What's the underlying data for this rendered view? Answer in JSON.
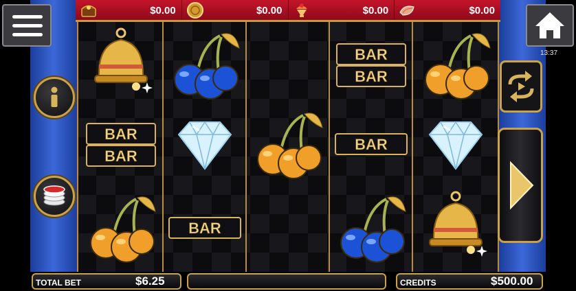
{
  "jackpots": [
    {
      "icon": "treasure-chest-icon",
      "value": "$0.00"
    },
    {
      "icon": "gold-coin-icon",
      "value": "$0.00"
    },
    {
      "icon": "sundae-icon",
      "value": "$0.00"
    },
    {
      "icon": "seashell-icon",
      "value": "$0.00"
    }
  ],
  "status": {
    "clock": "13:37"
  },
  "reels": [
    [
      "bell",
      "double-bar",
      "cherries-gold"
    ],
    [
      "cherries-blue",
      "diamond",
      "single-bar"
    ],
    [
      "empty",
      "cherries-gold",
      "empty"
    ],
    [
      "double-bar",
      "single-bar",
      "cherries-blue"
    ],
    [
      "cherries-gold",
      "diamond",
      "bell"
    ]
  ],
  "symbol_text": {
    "bar": "BAR"
  },
  "footer": {
    "total_bet_label": "TOTAL BET",
    "total_bet_value": "$6.25",
    "message": "",
    "credits_label": "CREDITS",
    "credits_value": "$500.00"
  },
  "buttons": {
    "menu": "hamburger-menu-icon",
    "home": "home-icon",
    "info": "info-icon",
    "bet": "chip-stack-icon",
    "autoplay": "autoplay-icon",
    "spin": "play-icon"
  },
  "colors": {
    "gold": "#c9a24a",
    "jackpot_red": "#c4142a",
    "frame_blue": "#2f5cc8"
  }
}
